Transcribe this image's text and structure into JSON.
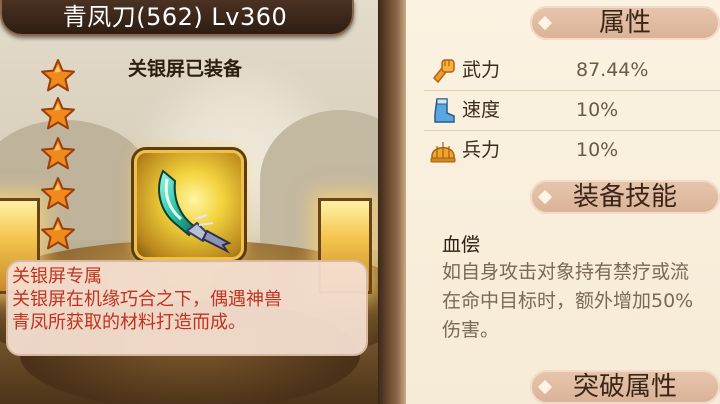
{
  "item": {
    "title": "青凤刀(562)   Lv360",
    "equipped_text": "关银屏已装备",
    "stars": 5,
    "exclusive_title": "关银屏专属",
    "description_lines": [
      "关银屏在机缘巧合之下，偶遇神兽",
      "青凤所获取的材料打造而成。"
    ]
  },
  "attributes": {
    "header": "属性",
    "rows": [
      {
        "name": "武力",
        "value": "87.44%",
        "icon": "fist-icon"
      },
      {
        "name": "速度",
        "value": "10%",
        "icon": "boot-icon"
      },
      {
        "name": "兵力",
        "value": "10%",
        "icon": "helmet-icon"
      }
    ]
  },
  "skill": {
    "header": "装备技能",
    "name": "血偿",
    "lines": [
      "如自身攻击对象持有禁疗或流",
      "在命中目标时，额外增加50%",
      "伤害。"
    ]
  },
  "breakthrough": {
    "header": "突破属性"
  },
  "colors": {
    "accent_red": "#c0331e",
    "star": "#f08a1c"
  }
}
